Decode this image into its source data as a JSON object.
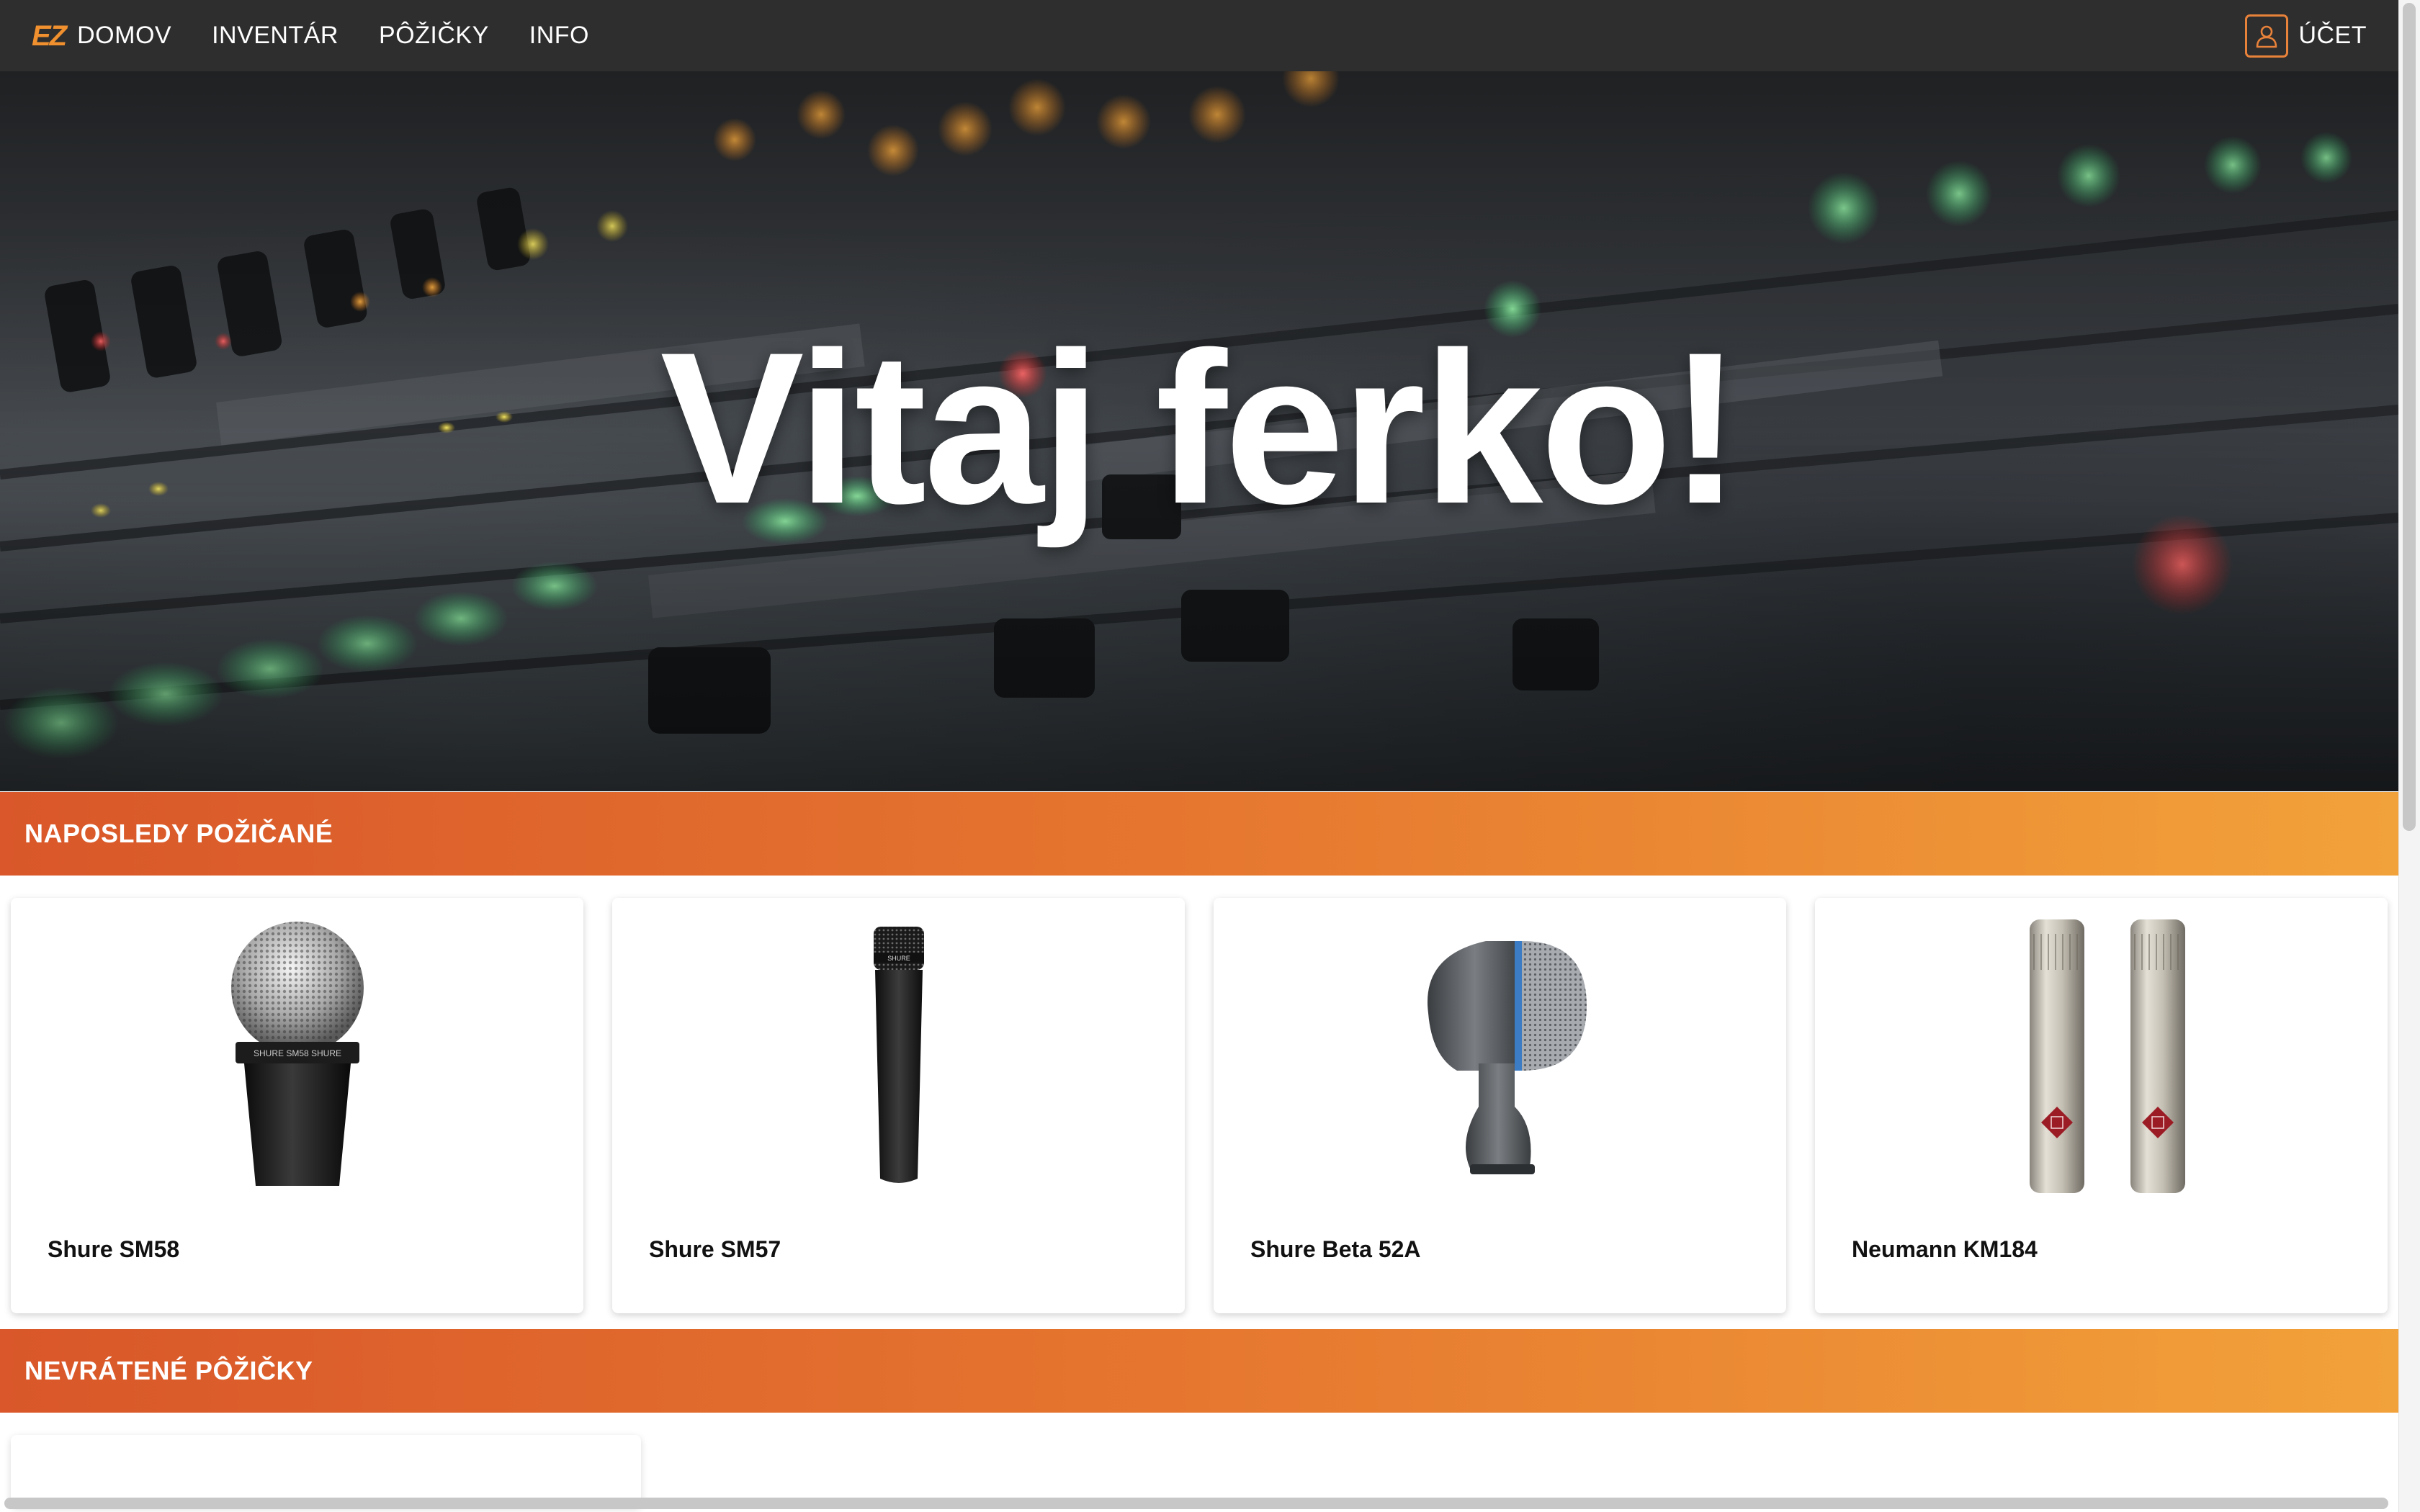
{
  "navbar": {
    "logo": "EZ",
    "links": [
      "DOMOV",
      "INVENTÁR",
      "PÔŽIČKY",
      "INFO"
    ],
    "account_label": "ÚČET",
    "account_icon": "user-icon",
    "accent_color": "#e8823a",
    "background": "#2e2e2e"
  },
  "hero": {
    "title": "Vitaj ferko!"
  },
  "sections": {
    "recent": {
      "title": "NAPOSLEDY POŽIČANÉ",
      "items": [
        {
          "name": "Shure SM58",
          "image": "shure-sm58-microphone"
        },
        {
          "name": "Shure SM57",
          "image": "shure-sm57-microphone"
        },
        {
          "name": "Shure Beta 52A",
          "image": "shure-beta-52a-microphone"
        },
        {
          "name": "Neumann KM184",
          "image": "neumann-km184-pair"
        }
      ]
    },
    "unreturned": {
      "title": "NEVRÁTENÉ PÔŽIČKY"
    }
  },
  "colors": {
    "banner_gradient_start": "#d9572a",
    "banner_gradient_end": "#f2a23a"
  }
}
